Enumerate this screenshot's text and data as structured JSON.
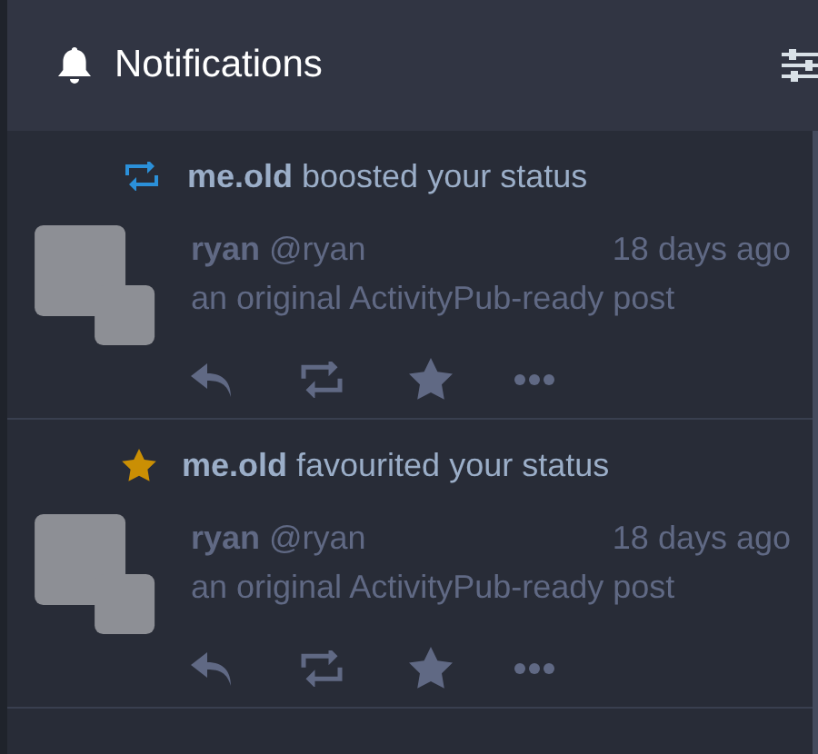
{
  "header": {
    "title": "Notifications"
  },
  "notifications": [
    {
      "kind": "reblog",
      "message": "**me.old** boosted your status",
      "status": {
        "display_name": "ryan",
        "handle": "@ryan",
        "time": "18 days ago",
        "content": "an original ActivityPub-ready post"
      }
    },
    {
      "kind": "favourite",
      "message": "**me.old** favourited your status",
      "status": {
        "display_name": "ryan",
        "handle": "@ryan",
        "time": "18 days ago",
        "content": "an original ActivityPub-ready post"
      }
    }
  ]
}
